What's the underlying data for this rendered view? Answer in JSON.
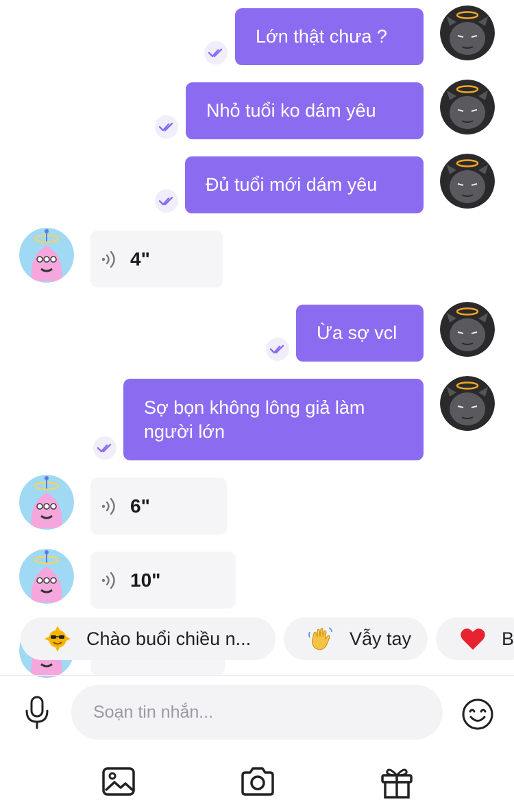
{
  "colors": {
    "accent": "#8b6cf0",
    "incoming_bg": "#f5f5f7",
    "seen_bg": "#efeefa"
  },
  "messages": [
    {
      "direction": "out",
      "type": "text",
      "text": "Lớn thật chưa ?"
    },
    {
      "direction": "out",
      "type": "text",
      "text": "Nhỏ tuổi ko dám yêu"
    },
    {
      "direction": "out",
      "type": "text",
      "text": "Đủ tuổi mới dám yêu"
    },
    {
      "direction": "in",
      "type": "voice",
      "duration": "4\""
    },
    {
      "direction": "out",
      "type": "text",
      "text": "Ừa sợ vcl"
    },
    {
      "direction": "out",
      "type": "text",
      "text": "Sợ bọn không lông giả làm người lớn"
    },
    {
      "direction": "in",
      "type": "voice",
      "duration": "6\""
    },
    {
      "direction": "in",
      "type": "voice",
      "duration": "10\""
    }
  ],
  "quick_replies": [
    {
      "icon": "sun-sunglasses-emoji",
      "label": "Chào buổi chiều n..."
    },
    {
      "icon": "waving-hand-emoji",
      "label": "Vẫy tay"
    },
    {
      "icon": "red-heart-emoji",
      "label": "Bo"
    }
  ],
  "composer": {
    "placeholder": "Soạn tin nhắn..."
  },
  "icons": {
    "mic": "microphone-icon",
    "emoji": "smiley-icon",
    "gallery": "image-icon",
    "camera": "camera-icon",
    "gift": "gift-icon"
  }
}
